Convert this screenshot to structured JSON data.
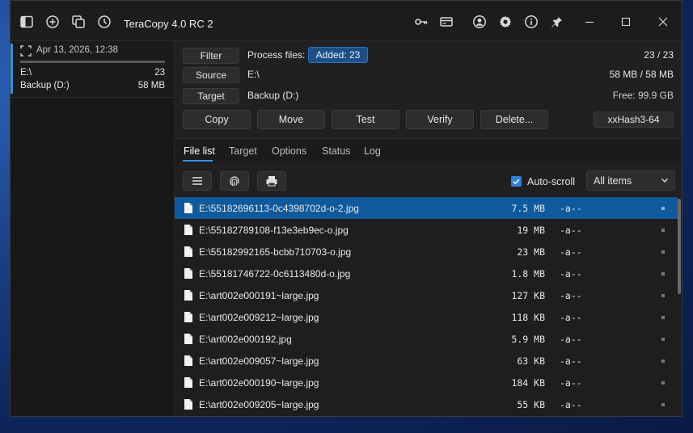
{
  "window": {
    "title": "TeraCopy 4.0 RC 2"
  },
  "titlebar_icons": [
    "sidebar-toggle-icon",
    "add-icon",
    "copy-windows-icon",
    "history-icon"
  ],
  "titlebar_right_icons": [
    "key-icon",
    "card-icon",
    "account-icon",
    "settings-icon",
    "info-icon",
    "pin-icon"
  ],
  "window_controls": [
    "minimize-icon",
    "maximize-icon",
    "close-icon"
  ],
  "sidebar": {
    "job": {
      "date": "Apr 13, 2026, 12:38",
      "source": "E:\\",
      "count": "23",
      "target": "Backup (D:)",
      "size": "58 MB",
      "progress": 1.0
    }
  },
  "panel": {
    "filter_label": "Filter",
    "source_label": "Source",
    "target_label": "Target",
    "process_files_label": "Process files:",
    "added_badge": "Added: 23",
    "source_value": "E:\\",
    "target_value": "Backup (D:)",
    "count_ratio": "23 / 23",
    "size_ratio": "58 MB / 58 MB",
    "free_space": "Free: 99.9 GB"
  },
  "actions": {
    "copy": "Copy",
    "move": "Move",
    "test": "Test",
    "verify": "Verify",
    "delete": "Delete...",
    "hash": "xxHash3-64"
  },
  "tabs": [
    "File list",
    "Target",
    "Options",
    "Status",
    "Log"
  ],
  "active_tab": "File list",
  "toolbar": {
    "autoscroll_label": "Auto-scroll",
    "autoscroll_checked": true,
    "filter_select": "All items"
  },
  "files": [
    {
      "name": "E:\\55182696113-0c4398702d-o-2.jpg",
      "size": "7.5 MB",
      "attr": "-a--"
    },
    {
      "name": "E:\\55182789108-f13e3eb9ec-o.jpg",
      "size": "19 MB",
      "attr": "-a--"
    },
    {
      "name": "E:\\55182992165-bcbb710703-o.jpg",
      "size": "23 MB",
      "attr": "-a--"
    },
    {
      "name": "E:\\55181746722-0c6113480d-o.jpg",
      "size": "1.8 MB",
      "attr": "-a--"
    },
    {
      "name": "E:\\art002e000191~large.jpg",
      "size": "127 KB",
      "attr": "-a--"
    },
    {
      "name": "E:\\art002e009212~large.jpg",
      "size": "118 KB",
      "attr": "-a--"
    },
    {
      "name": "E:\\art002e000192.jpg",
      "size": "5.9 MB",
      "attr": "-a--"
    },
    {
      "name": "E:\\art002e009057~large.jpg",
      "size": "63 KB",
      "attr": "-a--"
    },
    {
      "name": "E:\\art002e000190~large.jpg",
      "size": "184 KB",
      "attr": "-a--"
    },
    {
      "name": "E:\\art002e009205~large.jpg",
      "size": "55 KB",
      "attr": "-a--"
    }
  ],
  "colors": {
    "accent": "#3a8ee6",
    "selected_row": "#0f5a9c",
    "window_bg": "#1f1f1f"
  }
}
